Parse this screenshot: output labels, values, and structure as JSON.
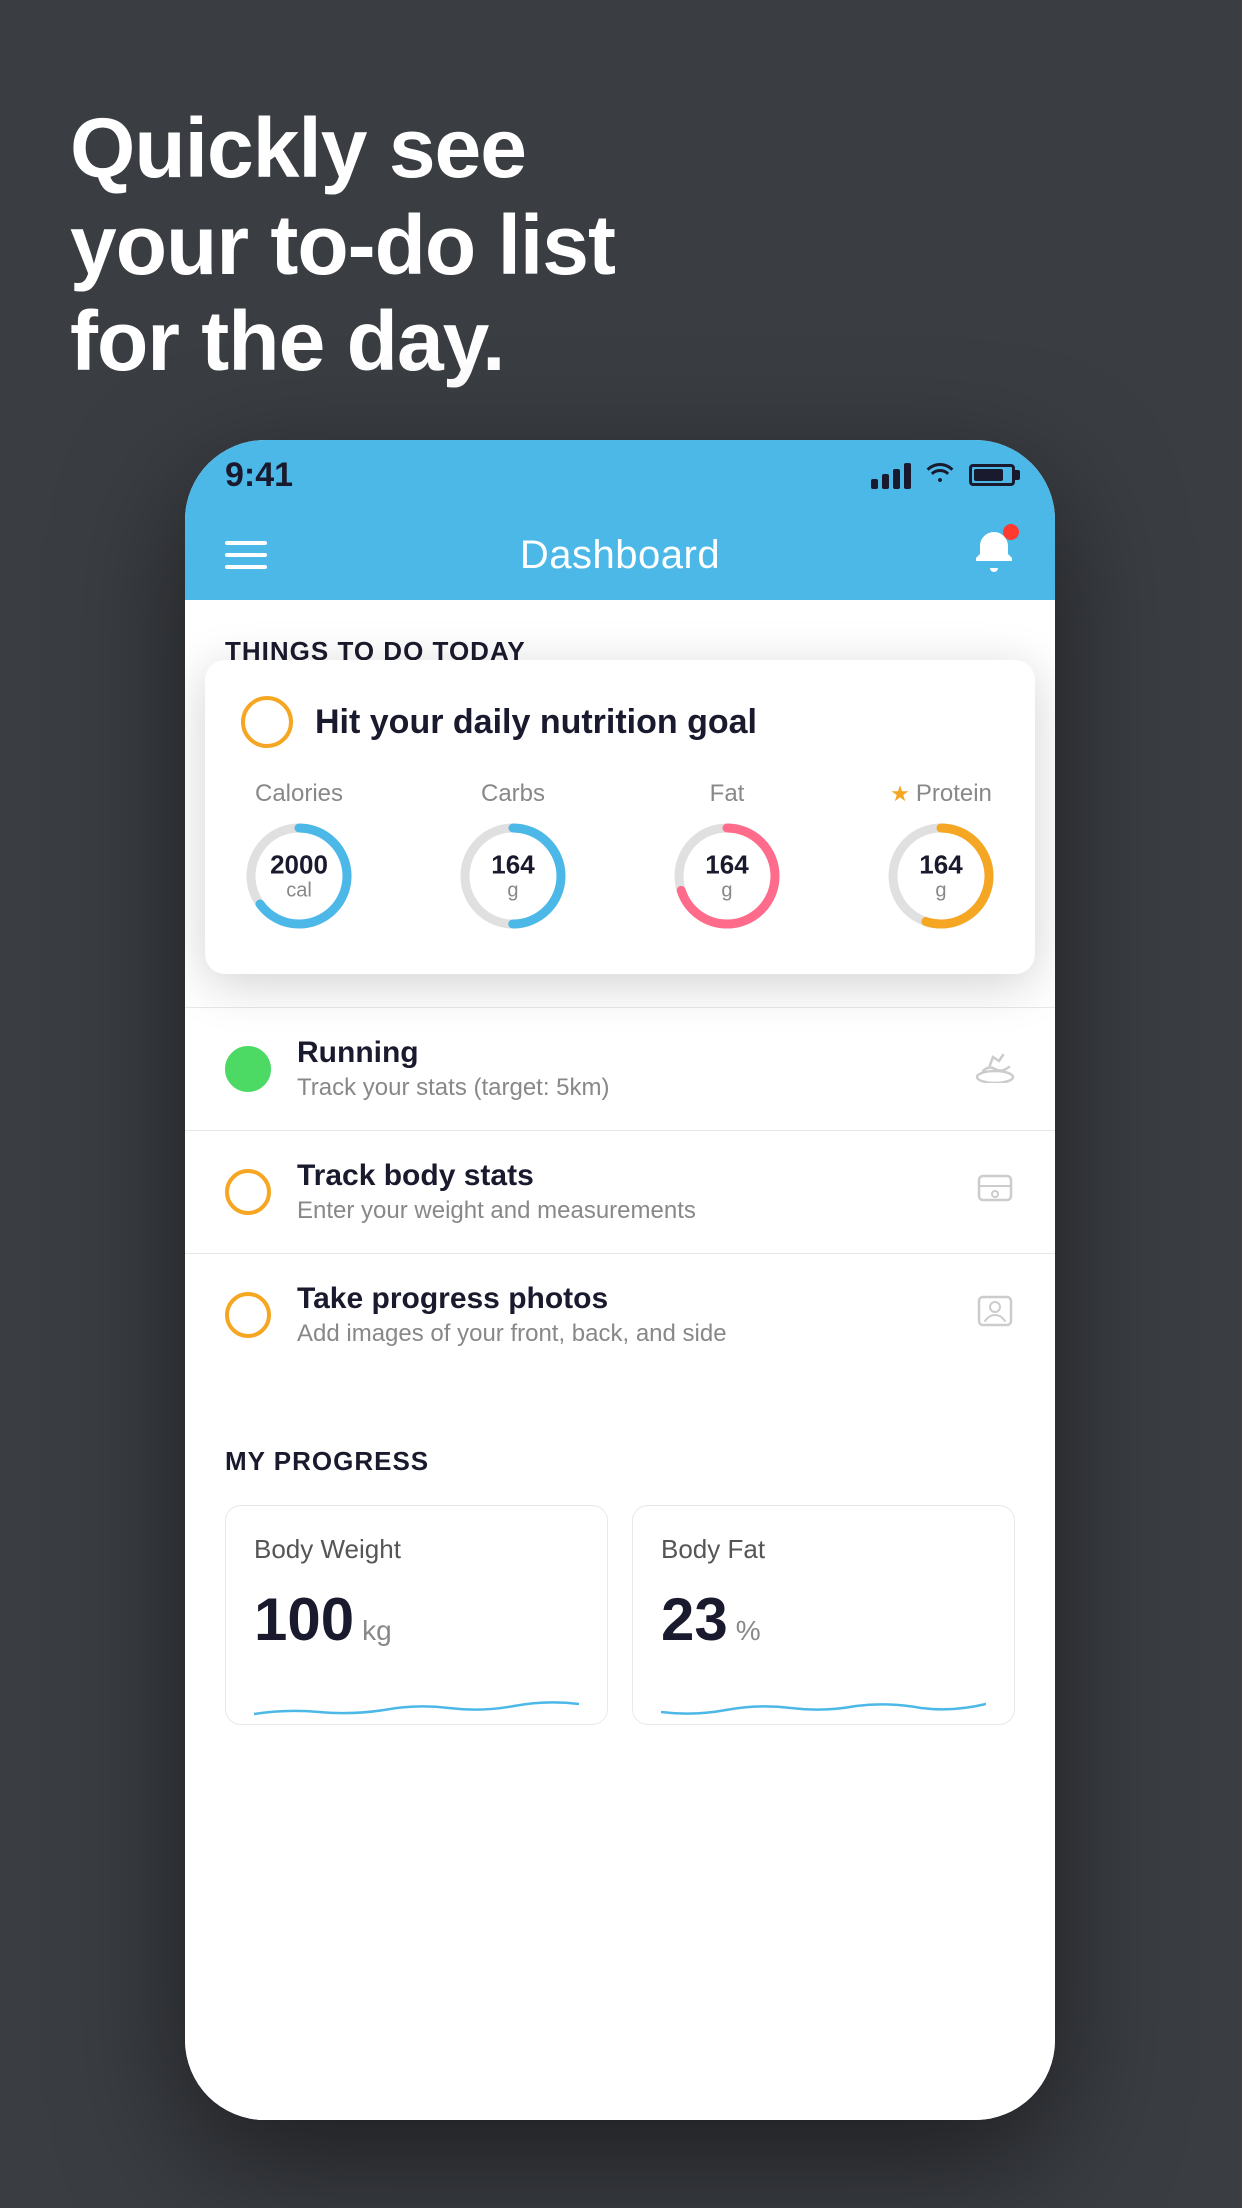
{
  "background": {
    "color": "#3a3d42"
  },
  "headline": {
    "line1": "Quickly see",
    "line2": "your to-do list",
    "line3": "for the day."
  },
  "status_bar": {
    "time": "9:41",
    "color": "#4cb8e8"
  },
  "header": {
    "title": "Dashboard",
    "color": "#4cb8e8"
  },
  "things_today": {
    "section_label": "THINGS TO DO TODAY",
    "featured_card": {
      "title": "Hit your daily nutrition goal",
      "circle_color": "#f5a623",
      "nutrients": [
        {
          "label": "Calories",
          "value": "2000",
          "unit": "cal",
          "color": "#4cb8e8",
          "progress": 0.65
        },
        {
          "label": "Carbs",
          "value": "164",
          "unit": "g",
          "color": "#4cb8e8",
          "progress": 0.5
        },
        {
          "label": "Fat",
          "value": "164",
          "unit": "g",
          "color": "#ff6b8a",
          "progress": 0.7
        },
        {
          "label": "Protein",
          "value": "164",
          "unit": "g",
          "color": "#f5a623",
          "progress": 0.55,
          "starred": true
        }
      ]
    },
    "items": [
      {
        "title": "Running",
        "subtitle": "Track your stats (target: 5km)",
        "check_type": "green",
        "icon": "shoe"
      },
      {
        "title": "Track body stats",
        "subtitle": "Enter your weight and measurements",
        "check_type": "orange",
        "icon": "scale"
      },
      {
        "title": "Take progress photos",
        "subtitle": "Add images of your front, back, and side",
        "check_type": "orange",
        "icon": "person"
      }
    ]
  },
  "progress": {
    "section_label": "MY PROGRESS",
    "cards": [
      {
        "title": "Body Weight",
        "value": "100",
        "unit": "kg"
      },
      {
        "title": "Body Fat",
        "value": "23",
        "unit": "%"
      }
    ]
  }
}
